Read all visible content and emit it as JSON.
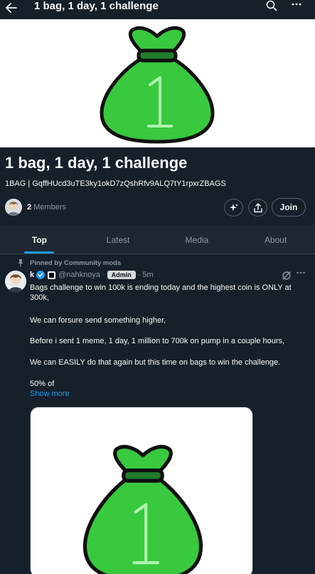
{
  "header": {
    "back_icon": "arrow-left-icon",
    "title": "1 bag, 1 day, 1 challenge",
    "search_icon": "search-icon",
    "more_icon": "more-horizontal-icon"
  },
  "banner": {
    "image": "green-money-bag-number-1",
    "bag_number": "1",
    "colors": {
      "bag": "#38c93f",
      "outline": "#111111",
      "band": "#1f7d2a",
      "number": "#aef5ae"
    }
  },
  "community": {
    "title": "1 bag, 1 day, 1 challenge",
    "description": "1BAG | GqffHUcd3uTE3ky1okD7zQshRfv9ALQ7tY1rpxrZBAGS",
    "member_count": "2",
    "members_label": "Members",
    "actions": {
      "grok_icon": "sparkle-icon",
      "share_icon": "share-icon",
      "join_label": "Join"
    }
  },
  "tabs": [
    {
      "label": "Top",
      "active": true
    },
    {
      "label": "Latest",
      "active": false
    },
    {
      "label": "Media",
      "active": false
    },
    {
      "label": "About",
      "active": false
    }
  ],
  "post": {
    "pinned_label": "Pinned by Community mods",
    "author_name": "k",
    "handle": "@nahknoya",
    "role_badge": "Admin",
    "time": "5m",
    "lines": [
      "Bags challenge to win 100k is ending today and the highest coin is ONLY at 300k,",
      "We can forsure send something higher,",
      "Before i sent 1 meme, 1 day, 1 million to 700k on pump in a couple hours,",
      "We can EASILY do that again but this time on bags to win the challenge.",
      "50% of"
    ],
    "show_more": "Show more",
    "media_image": "green-money-bag-number-1"
  },
  "colors": {
    "background": "#15202b",
    "tabs_bg": "#1e2732",
    "accent": "#1d9bf0",
    "muted_text": "#8b98a5",
    "border": "#536471"
  }
}
